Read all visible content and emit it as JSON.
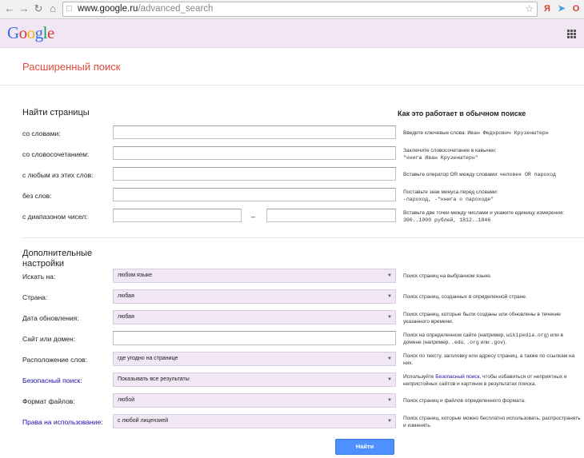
{
  "browser": {
    "url_domain": "www.google.ru",
    "url_path": "/advanced_search"
  },
  "header": {
    "logo_letters": [
      "G",
      "o",
      "o",
      "g",
      "l",
      "e"
    ],
    "logo_colors": [
      "#3a6ee8",
      "#d23f31",
      "#f2b50f",
      "#3a6ee8",
      "#109d58",
      "#d23f31"
    ]
  },
  "page": {
    "title": "Расширенный поиск",
    "find_pages_heading": "Найти страницы",
    "how_it_works_heading": "Как это работает в обычном поиске",
    "additional_heading_line1": "Дополнительные",
    "additional_heading_line2": "настройки",
    "range_dash": "–",
    "submit_label": "Найти"
  },
  "find_rows": [
    {
      "label": "со словами:",
      "hint_line1": "Введите ключевые слова: ",
      "hint_mono": "Иван Федорович Крузенштерн",
      "hint_line2": ""
    },
    {
      "label": "со словосочетанием:",
      "hint_line1": "Заключите словосочетание в кавычки:",
      "hint_mono": "\"книга Иван Крузенштерн\"",
      "hint_line2": ""
    },
    {
      "label": "с любым из этих слов:",
      "hint_line1": "Вставьте оператор OR между словами: ",
      "hint_mono": "человек OR пароход",
      "hint_line2": ""
    },
    {
      "label": "без слов:",
      "hint_line1": "Поставьте знак минуса перед словами:",
      "hint_mono": "-пароход, -\"книга о пароходе\"",
      "hint_line2": ""
    },
    {
      "label": "с диапазоном чисел:",
      "hint_line1": "Вставьте две точки между числами и укажите единицу измерения:",
      "hint_mono": "300..1000 рублей, 1812..1846",
      "hint_line2": ""
    }
  ],
  "settings_rows": [
    {
      "label": "Искать на:",
      "value": "любом языке",
      "hint": "Поиск страниц на выбранном языке."
    },
    {
      "label": "Страна:",
      "value": "любая",
      "hint": "Поиск страниц, созданных в определенной стране."
    },
    {
      "label": "Дата обновления:",
      "value": "любая",
      "hint": "Поиск страниц, которые были созданы или обновлены в течение указанного времени."
    },
    {
      "label": "Сайт или домен:",
      "value": "",
      "hint_a": "Поиск на определенном сайте (например, ",
      "hint_mono1": "wikipedia.org",
      "hint_b": ") или в домене (например, ",
      "hint_mono2": ".edu",
      "hint_c": ", ",
      "hint_mono3": ".org",
      "hint_d": " или ",
      "hint_mono4": ".gov",
      "hint_e": ")."
    },
    {
      "label": "Расположение слов:",
      "value": "где угодно на странице",
      "hint": "Поиск по тексту, заголовку или адресу страниц, а также по ссылкам на них."
    },
    {
      "label": "Безопасный поиск:",
      "value": "Показывать все результаты",
      "hint_a": "Используйте ",
      "hint_link": "Безопасный поиск",
      "hint_b": ", чтобы избавиться от неприятных и непристойных сайтов и картинок в результатах поиска."
    },
    {
      "label": "Формат файлов:",
      "value": "любой",
      "hint": "Поиск страниц и файлов определенного формата."
    },
    {
      "label": "Права на использование:",
      "value": "с любой лицензией",
      "hint": "Поиск страниц, которые можно бесплатно использовать, распространять и изменять."
    }
  ]
}
